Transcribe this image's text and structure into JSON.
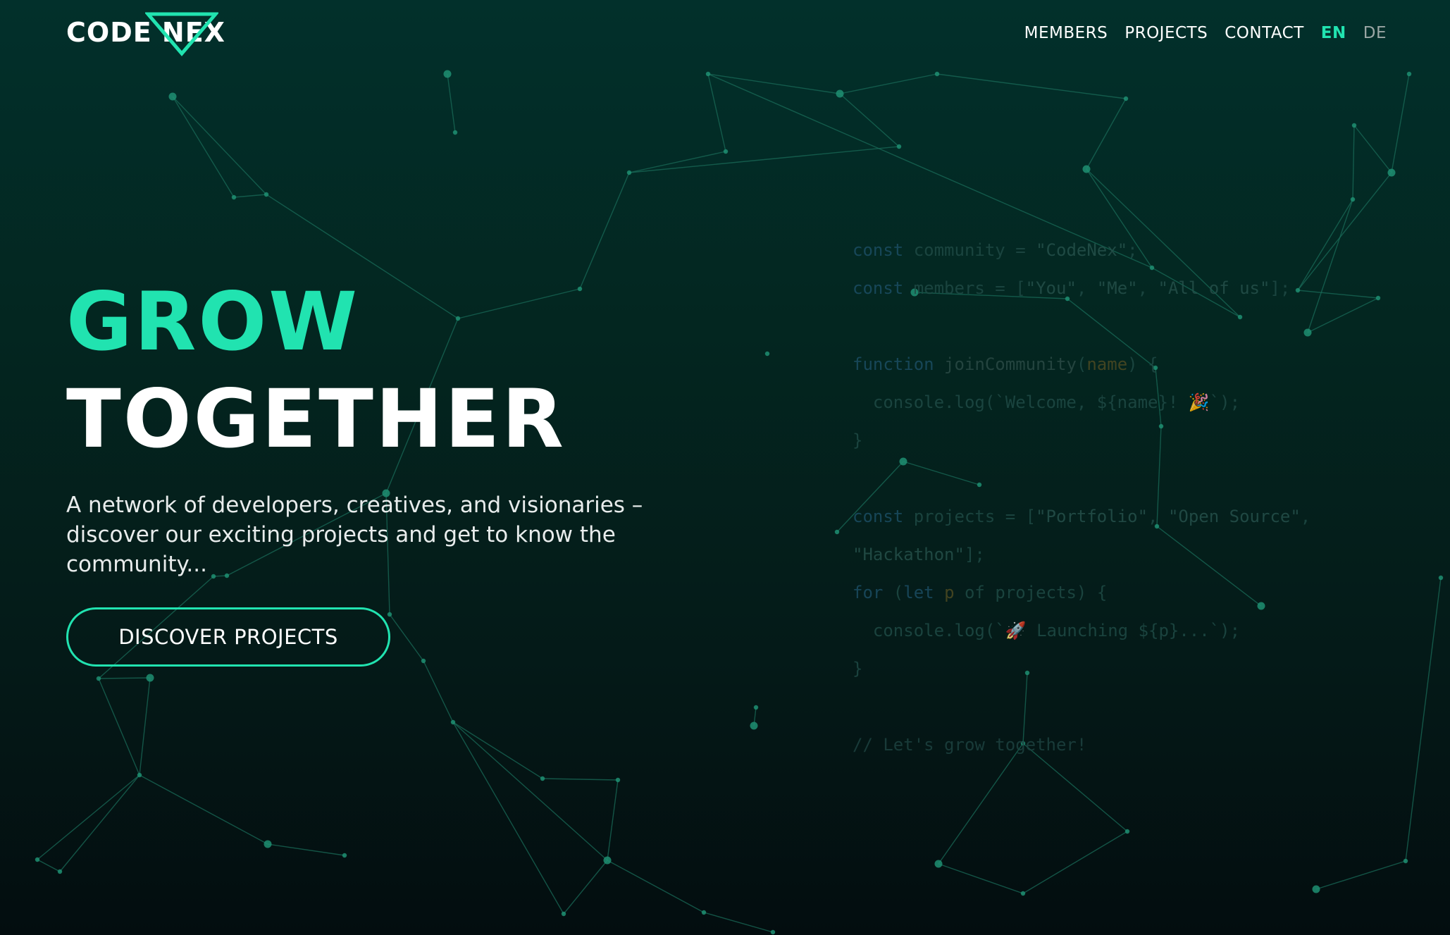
{
  "brand": {
    "name": "CODE NEX",
    "accent_color": "#21e3b0",
    "logo_icon": "triangle-logo-icon"
  },
  "nav": {
    "items": [
      {
        "label": "MEMBERS"
      },
      {
        "label": "PROJECTS"
      },
      {
        "label": "CONTACT"
      }
    ],
    "languages": [
      {
        "label": "EN",
        "active": true
      },
      {
        "label": "DE",
        "active": false
      }
    ]
  },
  "hero": {
    "title_line1": "GROW",
    "title_line2": "TOGETHER",
    "description": "A network of developers, creatives, and visionaries – discover our exciting projects and get to know the community...",
    "cta_label": "DISCOVER PROJECTS"
  },
  "code_snippet": {
    "lines": [
      "const community = \"CodeNex\";",
      "const members = [\"You\", \"Me\", \"All of us\"];",
      "",
      "function joinCommunity(name) {",
      "  console.log(`Welcome, ${name}! 🎉`);",
      "}",
      "",
      "const projects = [\"Portfolio\", \"Open Source\",",
      "\"Hackathon\"];",
      "for (let p of projects) {",
      "  console.log(`🚀 Launching ${p}...`);",
      "}",
      "",
      "// Let's grow together!"
    ]
  },
  "colors": {
    "background_top": "#02302b",
    "background_bottom": "#030d0f",
    "network_line": "#1a6b58",
    "network_node": "#1f8f72"
  }
}
